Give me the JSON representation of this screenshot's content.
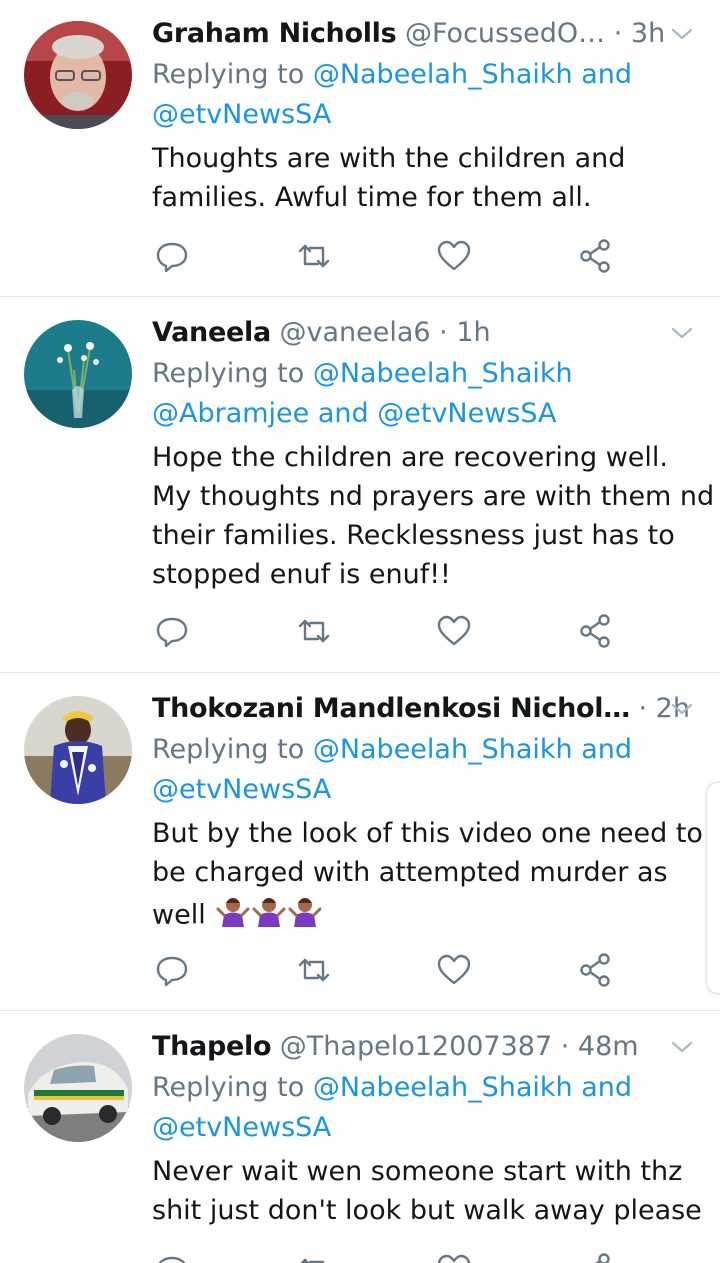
{
  "tweets": [
    {
      "name": "Graham Nicholls",
      "handle": "@FocussedO…",
      "time": "· 3h",
      "reply_prefix": "Replying to",
      "reply_line1_mentions": "@Nabeelah_Shaikh and",
      "reply_line2": "@etvNewsSA",
      "body": [
        "Thoughts are with the children and",
        "families. Awful time for them all."
      ]
    },
    {
      "name": "Vaneela",
      "handle": "@vaneela6",
      "time": "· 1h",
      "reply_prefix": "Replying to",
      "reply_line1_mentions": "@Nabeelah_Shaikh",
      "reply_line2": "@Abramjee and @etvNewsSA",
      "body": [
        "Hope the children are recovering well.",
        "My thoughts nd prayers are with them nd",
        "their families. Recklessness just has to",
        "stopped   enuf is enuf!!"
      ]
    },
    {
      "name": "Thokozani Mandlenkosi Nichol…",
      "handle": "",
      "time": "· 2h",
      "reply_prefix": "Replying to",
      "reply_line1_mentions": "@Nabeelah_Shaikh and",
      "reply_line2": "@etvNewsSA",
      "body": [
        "But by the look of this video one need to",
        "be charged with attempted murder  as",
        "well"
      ]
    },
    {
      "name": "Thapelo",
      "handle": "@Thapelo12007387",
      "time": "· 48m",
      "reply_prefix": "Replying to",
      "reply_line1_mentions": "@Nabeelah_Shaikh and",
      "reply_line2": "@etvNewsSA",
      "body": [
        "Never wait wen someone start with thz",
        "shit just don't look but walk away please"
      ]
    }
  ],
  "icons": [
    "chevron-down-icon",
    "reply-icon",
    "retweet-icon",
    "like-icon",
    "share-icon",
    "person-shrugging-emoji"
  ],
  "colors": {
    "link": "#1b95e0",
    "secondary_text": "#657786",
    "primary_text": "#14171a",
    "divider": "#e1e8ed"
  }
}
